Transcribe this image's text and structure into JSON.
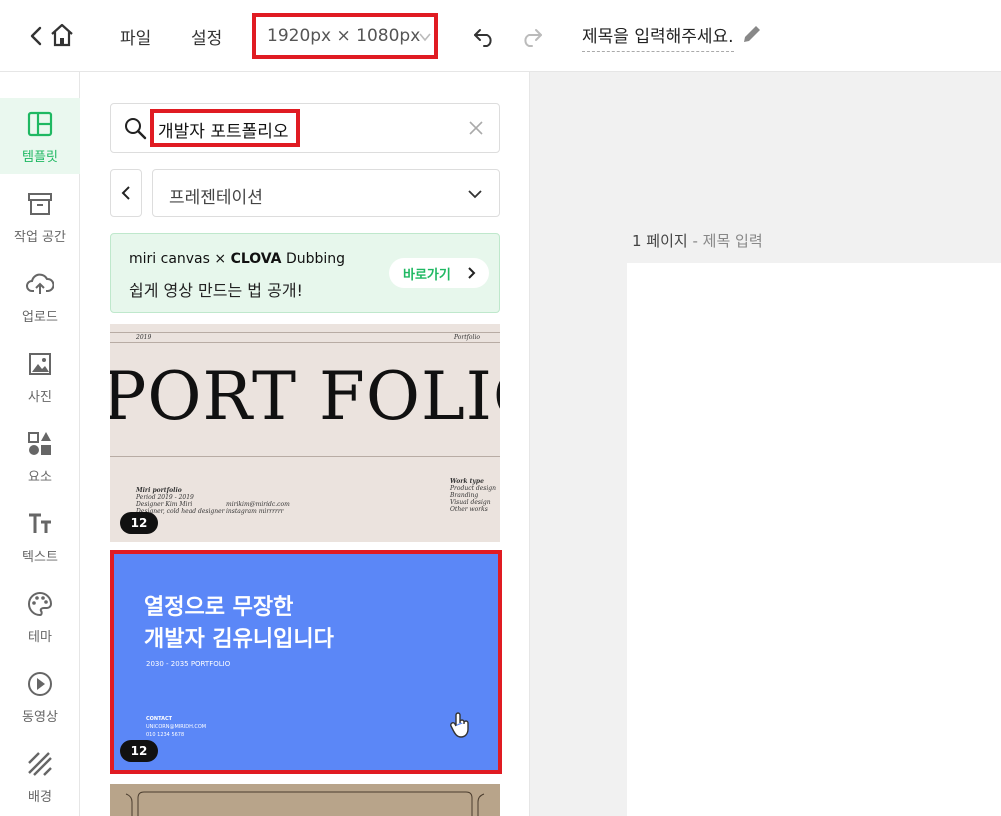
{
  "toolbar": {
    "file": "파일",
    "settings": "설정",
    "canvas_size": "1920px × 1080px",
    "doc_title": "제목을 입력해주세요."
  },
  "rail": {
    "items": [
      {
        "label": "템플릿",
        "icon": "layout-icon",
        "active": true
      },
      {
        "label": "작업 공간",
        "icon": "archive-icon"
      },
      {
        "label": "업로드",
        "icon": "cloud-upload-icon"
      },
      {
        "label": "사진",
        "icon": "image-icon"
      },
      {
        "label": "요소",
        "icon": "shapes-icon"
      },
      {
        "label": "텍스트",
        "icon": "text-icon"
      },
      {
        "label": "테마",
        "icon": "palette-icon"
      },
      {
        "label": "동영상",
        "icon": "play-circle-icon"
      },
      {
        "label": "배경",
        "icon": "stripes-icon"
      }
    ]
  },
  "panel": {
    "search_query": "개발자 포트폴리오",
    "category": "프레젠테이션",
    "banner": {
      "brand_left": "miri canvas",
      "brand_x": "×",
      "brand_right_bold": "CLOVA",
      "brand_right": "Dubbing",
      "message": "쉽게 영상 만드는 법 공개!",
      "cta": "바로가기"
    },
    "templates": [
      {
        "title": "PORT FOLIO",
        "year": "2019",
        "corner": "Portfolio",
        "col1": [
          "Miri portfolio",
          "Period  2019 - 2019",
          "Designer  Kim Miri",
          "Designer, cold head designer"
        ],
        "col2": [
          "mirikim@miridc.com",
          "instagram  mirrrrrr"
        ],
        "col3": [
          "Work type",
          "Product design",
          "Branding",
          "Visual design",
          "Other works"
        ],
        "pages": "12"
      },
      {
        "headline_1": "열정으로 무장한",
        "headline_2": "개발자 김유니입니다",
        "subline": "2030 - 2035 PORTFOLIO",
        "contact": [
          "CONTACT",
          "UNICORN@MIRIDH.COM",
          "010 1234 5678"
        ],
        "pages": "12"
      }
    ]
  },
  "canvas": {
    "page_number": "1 페이지",
    "page_title_placeholder": "- 제목 입력"
  },
  "colors": {
    "accent_green": "#1fb862",
    "highlight_red": "#e01b22",
    "card_blue": "#5b87f7"
  }
}
